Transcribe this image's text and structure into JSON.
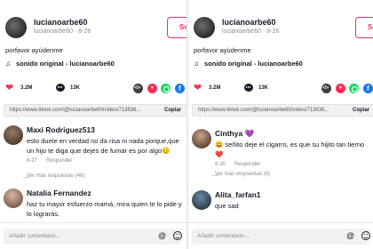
{
  "left": {
    "author": {
      "name": "lucianoarbe60",
      "meta": "lucianoarbe60 · 8-26",
      "follow": "Seguir"
    },
    "caption": "porfavor ayúdenme",
    "sound": "sonido original - lucianoarbe60",
    "likes": "3.2M",
    "comments_count": "13K",
    "link": "https://www.tiktok.com/@lucianoarbe60/video/713636...",
    "copy": "Copiar",
    "comments": [
      {
        "name": "Maxi Rodriguez513",
        "line1": "esto duele en verdad no da risa ni nada porque,que",
        "line2": "un hijo te diga que dejes de fumar es por algo😔",
        "date": "8-27",
        "reply": "Responder",
        "view_more": "Ver más respuestas (46)"
      },
      {
        "name": "Natalia Fernandez",
        "line1": "haz tu mayor esfuerzo mamá, mira quien te lo pide y",
        "line2": "lo lograrás."
      }
    ],
    "add_comment": "Añadir comentario..."
  },
  "right": {
    "author": {
      "name": "lucianoarbe60",
      "meta": "lucianoarbe60 · 8-26",
      "follow": "Seguir"
    },
    "caption": "porfavor ayúdenme",
    "sound": "sonido original - lucianoarbe60",
    "likes": "3.2M",
    "comments_count": "13K",
    "link": "https://www.tiktok.com/@lucianoarbe60/video/713636...",
    "copy": "Copiar",
    "comments": [
      {
        "name": "Cinthya 💜",
        "line1": "😀 señito deje el cigarro, es que su hijito tan tierno",
        "line2": "❤️",
        "date": "8-30",
        "reply": "Responder",
        "view_more": "Ver más respuestas (6)"
      },
      {
        "name": "Alita_farfan1",
        "line1": "que sad"
      }
    ],
    "add_comment": "Añadir comentario..."
  },
  "colors": {
    "accent": "#fe2c55",
    "whatsapp": "#25d366",
    "facebook": "#1877f2"
  },
  "icons": [
    "heart-icon",
    "comment-icon",
    "embed-icon",
    "send-icon",
    "whatsapp-icon",
    "facebook-icon",
    "at-icon",
    "emoji-icon",
    "music-note-icon"
  ]
}
